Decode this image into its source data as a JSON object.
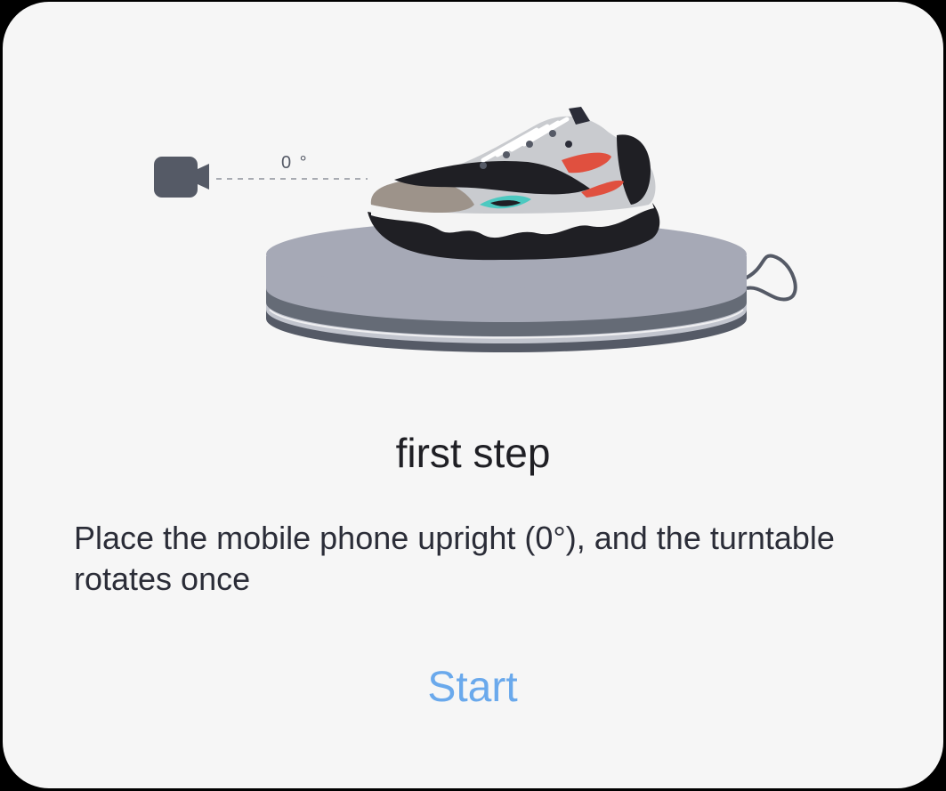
{
  "dialog": {
    "angle_label": "0 °",
    "title": "first step",
    "description": "Place the mobile phone upright (0°), and the turntable rotates once",
    "start_label": "Start"
  },
  "colors": {
    "accent": "#6aa9ec",
    "background": "#f6f6f6",
    "turntable": "#a6a9b6",
    "camera": "#555a66"
  },
  "icons": [
    "camera-icon",
    "shoe-illustration",
    "turntable-illustration"
  ]
}
